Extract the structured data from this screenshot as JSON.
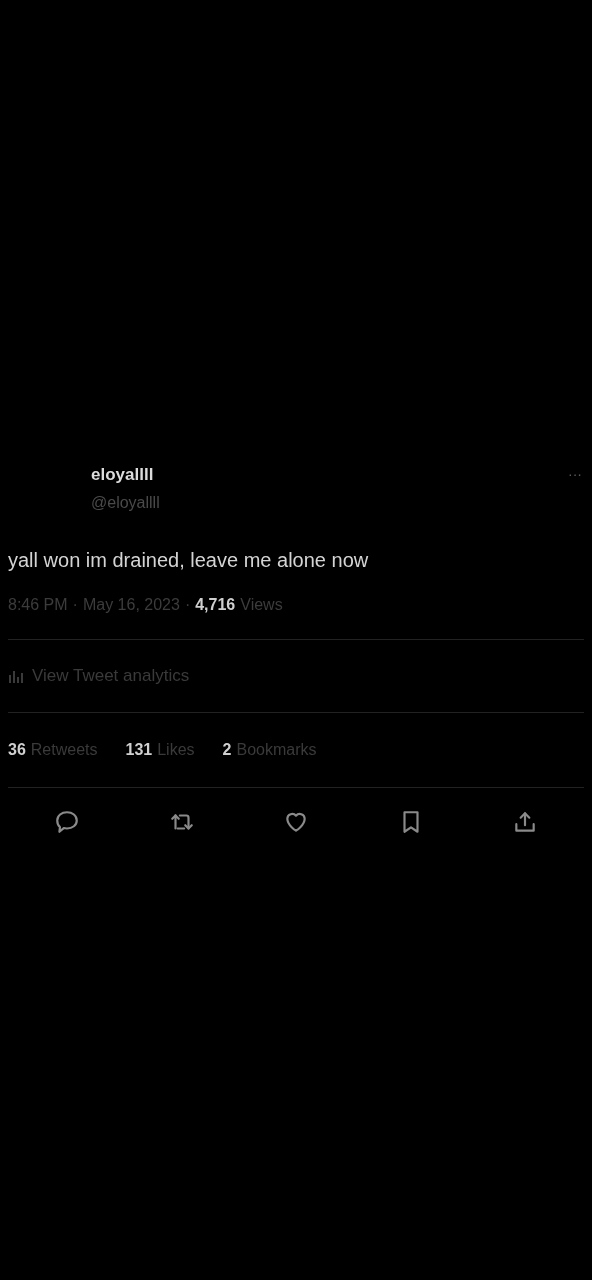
{
  "author": {
    "name": "eloyallll",
    "handle": "@eloyallll"
  },
  "more": "···",
  "tweet_text": "yall won im drained, leave me alone now",
  "meta": {
    "time": "8:46 PM",
    "separator_1": "·",
    "date": "May 16, 2023",
    "separator_2": "·",
    "views_count": "4,716",
    "views_label": "Views"
  },
  "analytics_link": "View Tweet analytics",
  "stats": [
    {
      "count": "36",
      "label": "Retweets"
    },
    {
      "count": "131",
      "label": "Likes"
    },
    {
      "count": "2",
      "label": "Bookmarks"
    }
  ],
  "actions": [
    {
      "kind": "reply"
    },
    {
      "kind": "retweet"
    },
    {
      "kind": "like"
    },
    {
      "kind": "bookmark"
    },
    {
      "kind": "share"
    }
  ]
}
